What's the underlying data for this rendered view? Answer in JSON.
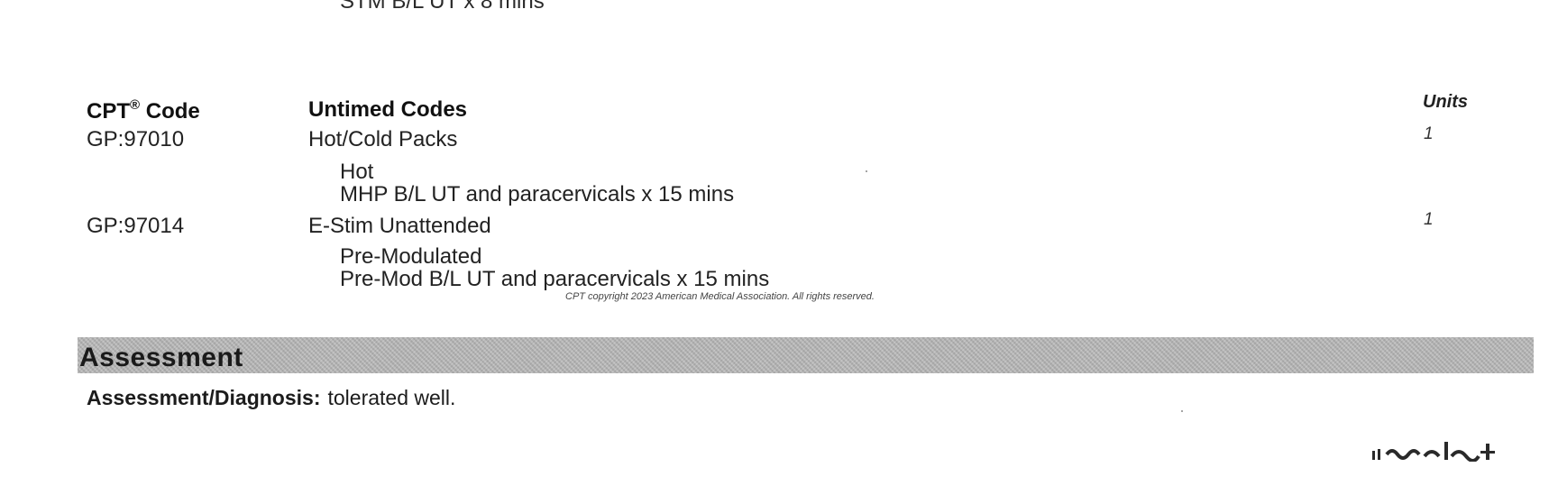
{
  "top_partial_line": "STM B/L UT x 8 mins",
  "table": {
    "header": {
      "code": "CPT",
      "code_sup": "®",
      "code_suffix": " Code",
      "description": "Untimed Codes",
      "units": "Units"
    },
    "rows": [
      {
        "code": "GP:97010",
        "description": "Hot/Cold Packs",
        "details": [
          "Hot",
          "MHP B/L UT and paracervicals x 15 mins"
        ],
        "units": "1"
      },
      {
        "code": "GP:97014",
        "description": "E-Stim Unattended",
        "details": [
          "Pre-Modulated",
          "Pre-Mod B/L UT and paracervicals x 15 mins"
        ],
        "units": "1"
      }
    ],
    "copyright": "CPT copyright 2023 American Medical Association.  All rights reserved."
  },
  "assessment": {
    "title": "Assessment",
    "label": "Assessment/Diagnosis:",
    "value": "tolerated well."
  },
  "colors": {
    "band": "#b9b9b9",
    "text": "#1c1c1c"
  }
}
